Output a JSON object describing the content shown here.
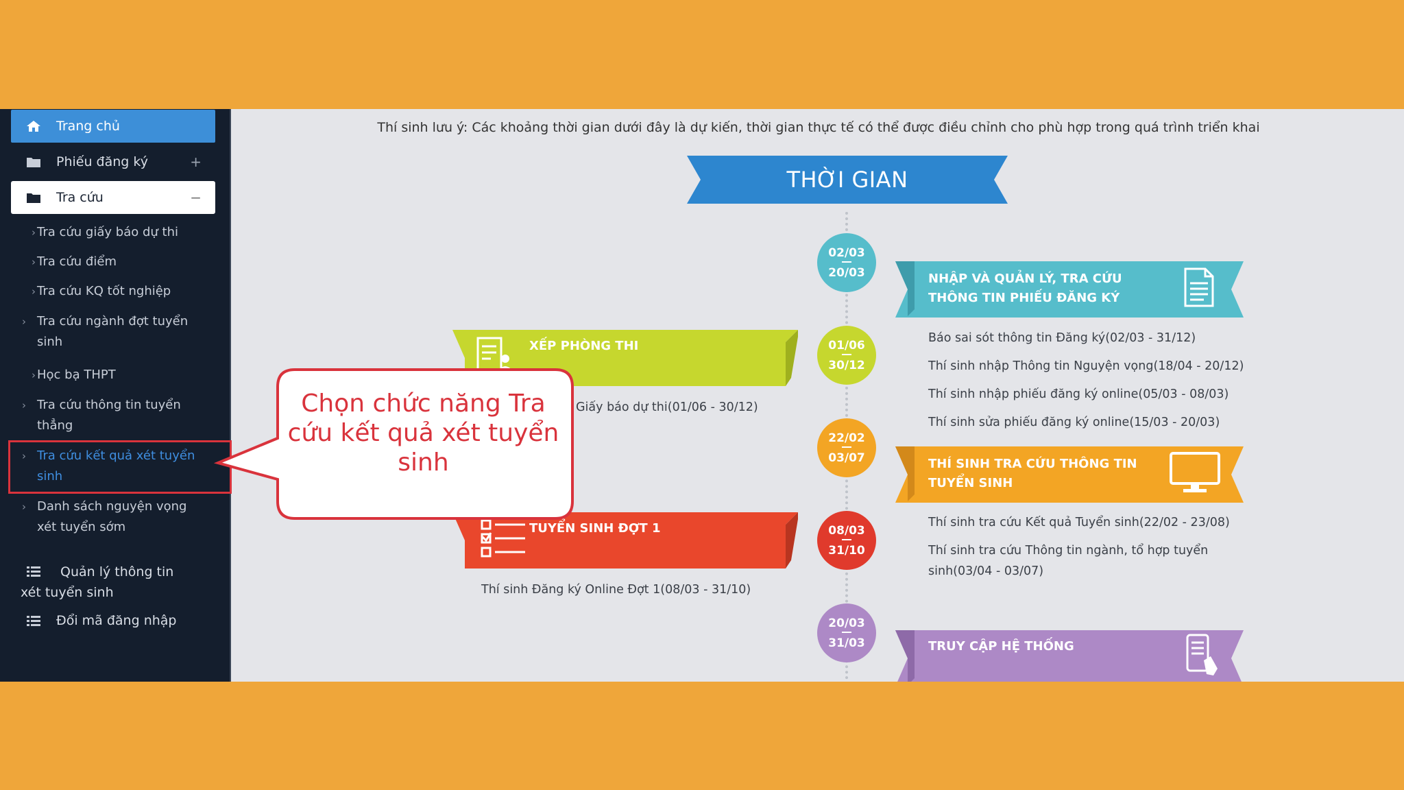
{
  "sidebar": {
    "home": "Trang chủ",
    "registration": "Phiếu đăng ký",
    "registration_toggle": "+",
    "lookup": "Tra cứu",
    "lookup_toggle": "−",
    "sub_items": [
      "Tra cứu giấy báo dự thi",
      "Tra cứu điểm",
      "Tra cứu KQ tốt nghiệp",
      "Tra cứu ngành đợt tuyển sinh",
      "Học bạ THPT",
      "Tra cứu thông tin tuyển thẳng",
      "Tra cứu kết quả xét tuyển sinh",
      "Danh sách nguyện vọng xét tuyển sớm"
    ],
    "admission_info": "Quản lý thông tin xét tuyển sinh",
    "change_password": "Đổi mã đăng nhập"
  },
  "notice": "Thí sinh lưu ý: Các khoảng thời gian dưới đây là dự kiến, thời gian thực tế có thể được điều chỉnh cho phù hợp trong quá trình triển khai",
  "timeline": {
    "title": "THỜI GIAN",
    "dates": [
      {
        "start": "02/03",
        "end": "20/03"
      },
      {
        "start": "01/06",
        "end": "30/12"
      },
      {
        "start": "22/02",
        "end": "03/07"
      },
      {
        "start": "08/03",
        "end": "31/10"
      },
      {
        "start": "20/03",
        "end": "31/03"
      }
    ],
    "ribbons": {
      "manage": "NHẬP VÀ QUẢN LÝ, TRA CỨU THÔNG TIN PHIẾU ĐĂNG KÝ",
      "exam_room": "XẾP PHÒNG THI",
      "lookup_info": "THÍ SINH TRA CỨU THÔNG TIN TUYỂN SINH",
      "round1": "TUYỂN SINH ĐỢT 1",
      "access": "TRUY CẬP HỆ THỐNG"
    },
    "details": {
      "manage": [
        "Báo sai sót thông tin Đăng ký(02/03 - 31/12)",
        "Thí sinh nhập Thông tin Nguyện vọng(18/04 - 20/12)",
        "Thí sinh nhập phiếu đăng ký online(05/03 - 08/03)",
        "Thí sinh sửa phiếu đăng ký online(15/03 - 20/03)"
      ],
      "exam_room": "Giấy báo dự thi(01/06 - 30/12)",
      "lookup_info": [
        "Thí sinh tra cứu Kết quả Tuyển sinh(22/02 - 23/08)",
        "Thí sinh tra cứu Thông tin ngành, tổ hợp tuyển sinh(03/04 - 03/07)"
      ],
      "round1": "Thí sinh Đăng ký Online Đợt 1(08/03 - 31/10)"
    }
  },
  "callout": "Chọn chức năng Tra cứu kết quả xét tuyển sinh",
  "colors": {
    "background": "#EFA63A",
    "sidebar": "#141E2D",
    "highlight": "#D9333C",
    "blue": "#2D86CF",
    "cyan": "#56BDCB",
    "lime": "#C6D72E",
    "orange": "#F3A524",
    "red": "#E9472C",
    "purple": "#AD89C6"
  }
}
